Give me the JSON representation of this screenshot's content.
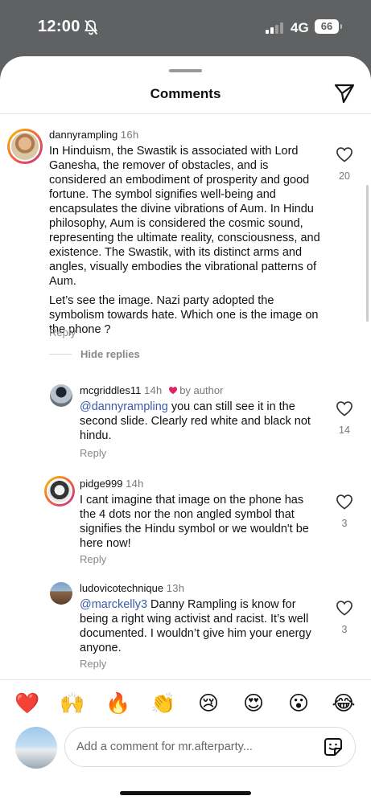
{
  "status_bar": {
    "time": "12:00",
    "network": "4G",
    "battery": "66"
  },
  "sheet": {
    "title": "Comments"
  },
  "comments": [
    {
      "username": "dannyrampling",
      "time": "16h",
      "paragraphs": [
        "In Hinduism, the Swastik is associated with Lord Ganesha, the remover of obstacles, and is considered an embodiment of prosperity and good fortune. The symbol signifies well-being and encapsulates the divine vibrations of Aum. In Hindu philosophy, Aum is considered the cosmic sound, representing the ultimate reality, consciousness, and existence. The Swastik, with its distinct arms and angles, visually embodies the vibrational patterns of Aum.",
        "Let’s see the image. Nazi party adopted the symbolism towards hate. Which one is the image on the phone ?"
      ],
      "reply_label": "Reply",
      "likes": "20"
    },
    {
      "username": "mcgriddles11",
      "time": "14h",
      "author_tag": "by author",
      "mention": "@dannyrampling",
      "text": " you can still see it in the second slide. Clearly red white and black not hindu.",
      "reply_label": "Reply",
      "likes": "14"
    },
    {
      "username": "pidge999",
      "time": "14h",
      "text": "I cant imagine that image on the phone has the 4 dots nor the non angled symbol that signifies the Hindu symbol or we wouldn't be here now!",
      "reply_label": "Reply",
      "likes": "3"
    },
    {
      "username": "ludovicotechnique",
      "time": "13h",
      "mention": "@marckelly3",
      "text": " Danny Rampling is know for being a right wing activist and racist. It’s well documented. I wouldn’t give him your energy anyone.",
      "reply_label": "Reply",
      "likes": "3"
    }
  ],
  "hide_replies_label": "Hide replies",
  "emojis": [
    "❤️",
    "🙌",
    "🔥",
    "👏",
    "😢",
    "😍",
    "😮",
    "😂"
  ],
  "composer": {
    "placeholder": "Add a comment for mr.afterparty..."
  },
  "colors": {
    "mention": "#3c5aa8",
    "heart": "#e0245e",
    "ring_start": "#f7c600",
    "ring_end": "#c13584"
  },
  "icons": [
    "bell-slash-icon",
    "signal-icon",
    "battery-icon",
    "share-send-icon",
    "heart-outline-icon",
    "red-heart-icon",
    "sticker-icon"
  ]
}
